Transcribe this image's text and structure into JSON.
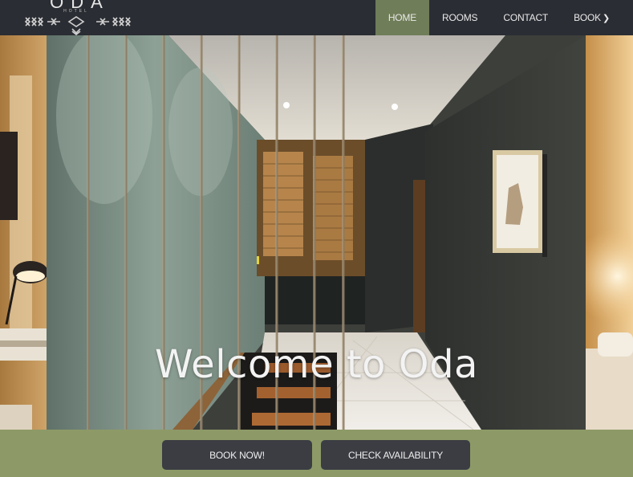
{
  "brand": {
    "name": "ODA",
    "subtitle": "HOTEL"
  },
  "nav": {
    "items": [
      {
        "label": "HOME",
        "active": true
      },
      {
        "label": "ROOMS",
        "active": false
      },
      {
        "label": "CONTACT",
        "active": false
      },
      {
        "label": "BOOK",
        "active": false,
        "icon": "chevron-right-icon"
      }
    ]
  },
  "hero": {
    "title": "Welcome to Oda"
  },
  "actions": {
    "book_now": "BOOK NOW!",
    "check_availability": "CHECK AVAILABILITY"
  },
  "colors": {
    "navbar": "#2a2d33",
    "active_nav": "#6f7d58",
    "accent_bar": "#8d9a67",
    "button": "#3b3d43"
  }
}
